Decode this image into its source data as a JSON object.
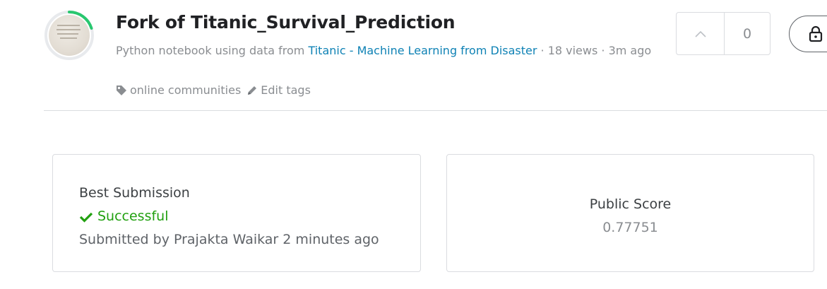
{
  "notebook": {
    "title": "Fork of Titanic_Survival_Prediction",
    "meta_prefix": "Python notebook using data from ",
    "dataset_link": "Titanic - Machine Learning from Disaster",
    "meta_suffix": " · 18 views · 3m ago",
    "avatar_progress": 0.18
  },
  "tags": {
    "tag_icon": "tag-icon",
    "tag_label": "online communities",
    "edit_icon": "pencil-icon",
    "edit_label": "Edit tags"
  },
  "vote": {
    "upvote_icon": "chevron-up-icon",
    "count": "0"
  },
  "lock": {
    "icon": "lock-icon"
  },
  "best_submission": {
    "label": "Best Submission",
    "status_icon": "check-icon",
    "status": "Successful",
    "submitted": "Submitted by Prajakta Waikar 2 minutes ago"
  },
  "public_score": {
    "label": "Public Score",
    "value": "0.77751"
  },
  "colors": {
    "accent_link": "#0f82b5",
    "success": "#21a010",
    "progress_ring": "#20beff"
  }
}
